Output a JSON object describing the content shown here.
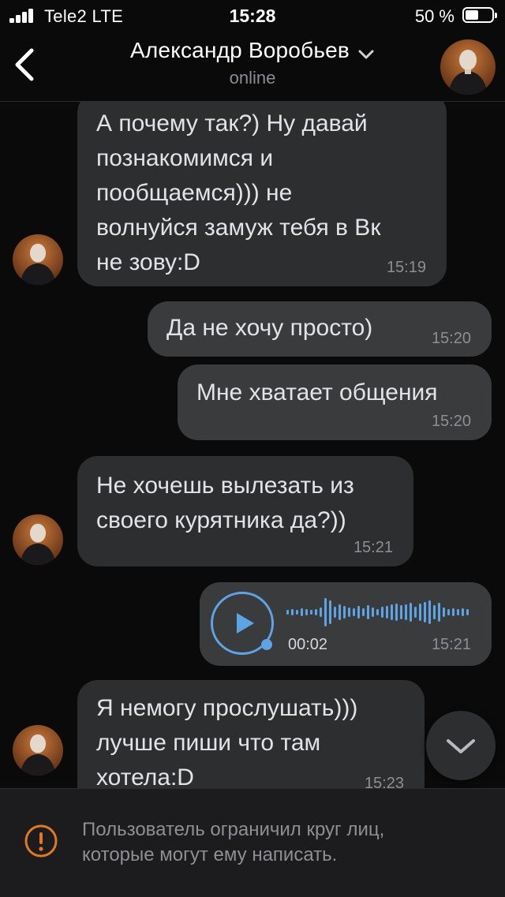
{
  "status_bar": {
    "carrier": "Tele2  LTE",
    "time": "15:28",
    "battery": "50 %",
    "battery_level": 0.5
  },
  "header": {
    "name": "Александр Воробьев",
    "status": "online",
    "back_icon": "chevron-left-icon",
    "dropdown_icon": "chevron-down-icon"
  },
  "messages": [
    {
      "direction": "in",
      "text": "А почему так?) Ну давай\nпознакомимся и\nпообщаемся))) не\nволнуйся замуж тебя в Вк\nне зову:D",
      "time": "15:19"
    },
    {
      "direction": "out",
      "text": "Да не хочу просто)",
      "time": "15:20"
    },
    {
      "direction": "out",
      "text": "Мне хватает общения",
      "time": "15:20"
    },
    {
      "direction": "in",
      "text": "Не хочешь вылезать из\nсвоего курятника да?))",
      "time": "15:21"
    },
    {
      "direction": "out",
      "type": "voice",
      "duration": "00:02",
      "time": "15:21"
    },
    {
      "direction": "in",
      "text": "Я немогу прослушать)))\nлучше пиши что там\nхотела:D",
      "time": "15:23"
    }
  ],
  "footer": {
    "notice": "Пользователь ограничил круг лиц,\nкоторые могут ему написать.",
    "icon": "warning-icon"
  },
  "colors": {
    "background": "#0a0a0a",
    "bubble_in": "#2d2e30",
    "bubble_out": "#3a3b3d",
    "accent": "#5ea3e3",
    "warning": "#e07a1f"
  }
}
